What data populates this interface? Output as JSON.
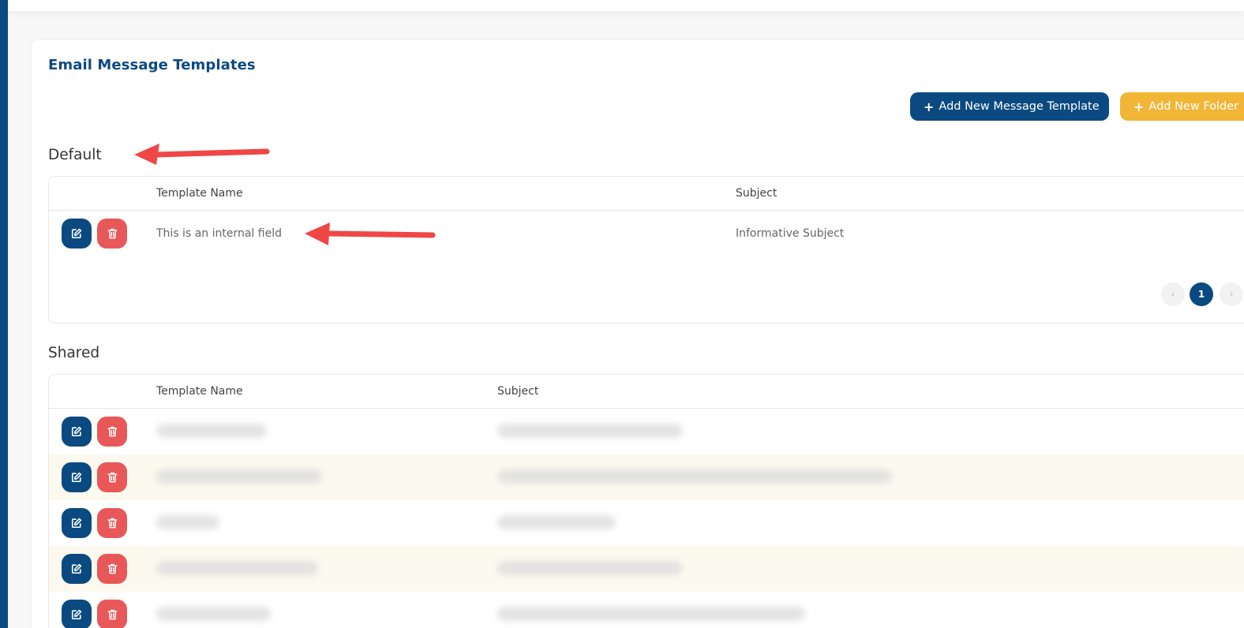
{
  "title": "Email Message Templates",
  "buttons": {
    "add_template": "Add New Message Template",
    "add_folder": "Add New Folder",
    "plus": "+"
  },
  "default_section": {
    "title": "Default",
    "columns": {
      "name": "Template Name",
      "subject": "Subject"
    },
    "rows": [
      {
        "name": "This is an internal field",
        "subject": "Informative Subject"
      }
    ],
    "pagination": {
      "current": "1",
      "prev": "‹",
      "next": "›"
    }
  },
  "shared_section": {
    "title": "Shared",
    "columns": {
      "name": "Template Name",
      "subject": "Subject"
    },
    "row_count_visible": 5
  },
  "colors": {
    "primary": "#0b4a80",
    "accent": "#f2b636",
    "danger": "#e85858",
    "row_alt": "#fcf9ef",
    "annotation_arrow": "#f04646"
  },
  "icons": {
    "edit": "edit-icon",
    "delete": "trash-icon",
    "annotation": "arrow-left-icon"
  }
}
